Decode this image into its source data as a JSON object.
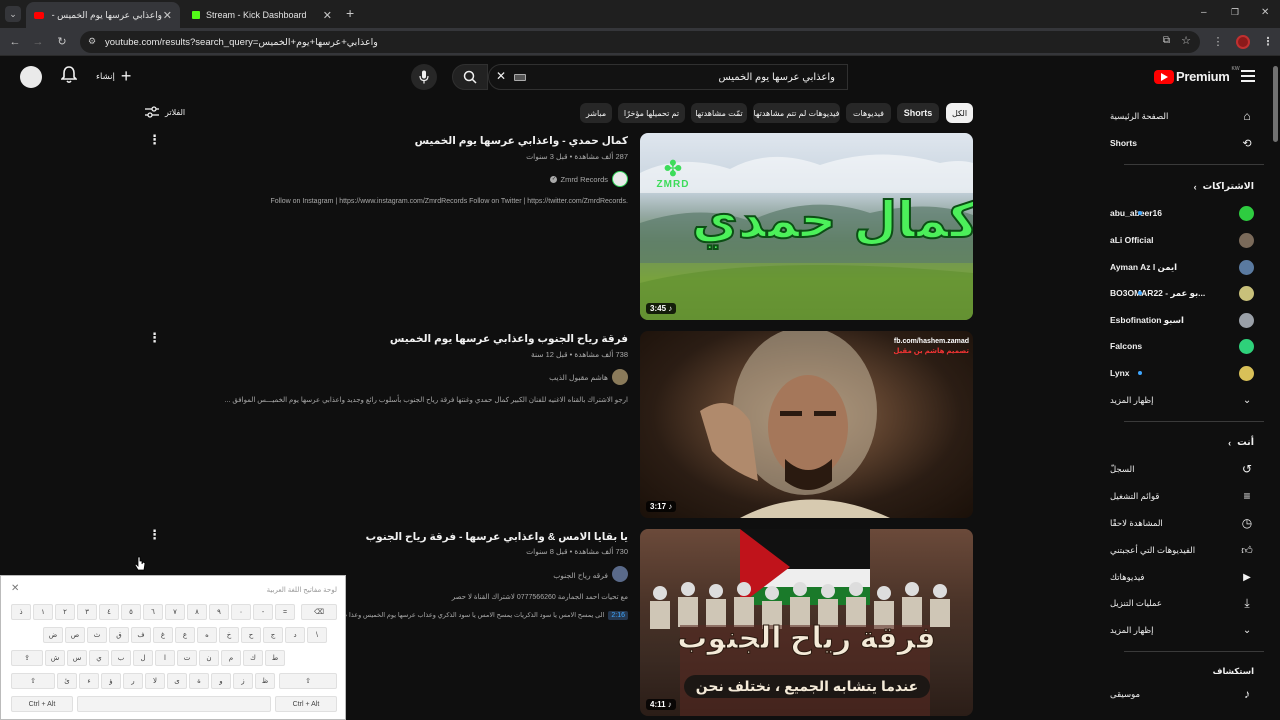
{
  "browser": {
    "tabs": [
      {
        "title": "واعذابي عرسها يوم الخميس - ube",
        "active": true
      },
      {
        "title": "Stream - Kick Dashboard",
        "active": false
      }
    ],
    "new_tab": "+",
    "url": "youtube.com/results?search_query=واعذابي+عرسها+يوم+الخميس",
    "window_controls": {
      "minimize": "–",
      "restore": "❐",
      "close": "✕"
    }
  },
  "header": {
    "logo_text": "Premium",
    "logo_sup": "KW",
    "search_value": "واعذابي عرسها يوم الخميس",
    "create_label": "إنشاء"
  },
  "chips": [
    "الكل",
    "Shorts",
    "فيديوهات",
    "فيديوهات لم تتم مشاهدتها",
    "تمّت مشاهدتها",
    "تم تحميلها مؤخرًا",
    "مباشر"
  ],
  "filters_label": "الفلاتر",
  "results": [
    {
      "title": "كمال حمدي - واعذابي عرسها يوم الخميس",
      "meta": "287 ألف مشاهدة • قبل 3 سنوات",
      "channel": "Zmrd Records",
      "verified": true,
      "description": "Follow on Instagram | https://www.instagram.com/ZmrdRecords Follow on Twitter | https://twitter.com/ZmrdRecords.",
      "duration": "3:45",
      "thumb_text": "كمال حمدي",
      "thumb_logo": "ZMRD"
    },
    {
      "title": "فرقة رياح الجنوب واعذابي عرسها يوم الخميس",
      "meta": "738 ألف مشاهدة • قبل 12 سنة",
      "channel": "هاشم مقبول الذيب",
      "verified": false,
      "description": "ارجو الاشتراك بالقناه الاغنيه للفنان الكبير كمال حمدي وغنتها فرقة رياح الجنوب بأسلوب رائع وجديد واعذابي عرسها يوم الخميـــس الموافق ...",
      "duration": "3:17",
      "thumb_text": "تصميم هاشم بن مقبل",
      "thumb_logo": "fb.com/hashem.zamad"
    },
    {
      "title": "يا بقايا الامس & واعذابي عرسها - فرقة رياح الجنوب",
      "meta": "730 ألف مشاهدة • قبل 8 سنوات",
      "channel": "فرقه رياح الجنوب",
      "verified": false,
      "description": "مع تحيات احمد الجمارمة 0777566260 لاشتراك القناة لا حصر",
      "chapter_time": "2:16",
      "chapter_text": "الى يمسح الامس يا سود الذكريات يمسح الامس يا سود الذكري وعذاب عرسها يوم الخميس وعذا ب ...",
      "duration": "4:11",
      "thumb_text": "فرقة رياح الجنوب",
      "thumb_sub": "عندما يتشابه الجميع ، نختلف نحن"
    }
  ],
  "sidebar": {
    "top": [
      {
        "label": "الصفحة الرئيسية",
        "icon": "home-icon"
      },
      {
        "label": "Shorts",
        "icon": "shorts-icon"
      }
    ],
    "subs_heading": "الاشتراكات",
    "subs": [
      {
        "label": "abu_abeer16",
        "dot": true,
        "color": "#2ecc40"
      },
      {
        "label": "aLi Official",
        "dot": false,
        "color": "#7a6a5a"
      },
      {
        "label": "Ayman Az l ايمن",
        "dot": false,
        "color": "#5a7aa0"
      },
      {
        "label": "BO3OMAR22 - بو عمر...",
        "dot": true,
        "color": "#c8c07a"
      },
      {
        "label": "Esbofination اسبو",
        "dot": false,
        "color": "#9aa0a8"
      },
      {
        "label": "Falcons",
        "dot": false,
        "color": "#2ed17a"
      },
      {
        "label": "Lynx",
        "dot": true,
        "color": "#d8c058"
      }
    ],
    "show_more": "إظهار المزيد",
    "you_heading": "أنت",
    "you": [
      {
        "label": "السجلّ",
        "icon": "history-icon"
      },
      {
        "label": "قوائم التشغيل",
        "icon": "playlists-icon"
      },
      {
        "label": "المشاهدة لاحقًا",
        "icon": "watch-later-icon"
      },
      {
        "label": "الفيديوهات التي أعجبتني",
        "icon": "like-icon"
      },
      {
        "label": "فيديوهاتك",
        "icon": "your-videos-icon"
      },
      {
        "label": "عمليات التنزيل",
        "icon": "download-icon"
      }
    ],
    "show_more_2": "إظهار المزيد",
    "explore_heading": "استكشاف",
    "explore": [
      {
        "label": "موسيقى",
        "icon": "music-icon"
      }
    ]
  },
  "keyboard": {
    "title": "لوحة مفاتيح اللغة العربية",
    "row1": [
      "ذ",
      "١",
      "٢",
      "٣",
      "٤",
      "٥",
      "٦",
      "٧",
      "٨",
      "٩",
      "٠",
      "-",
      "="
    ],
    "row2": [
      "ض",
      "ص",
      "ث",
      "ق",
      "ف",
      "غ",
      "ع",
      "ه",
      "خ",
      "ح",
      "ج",
      "د",
      "\\"
    ],
    "row3": [
      "ش",
      "س",
      "ي",
      "ب",
      "ل",
      "ا",
      "ت",
      "ن",
      "م",
      "ك",
      "ط"
    ],
    "row4": [
      "ئ",
      "ء",
      "ؤ",
      "ر",
      "لا",
      "ى",
      "ة",
      "و",
      "ز",
      "ظ"
    ],
    "ctrl_alt": "Ctrl + Alt"
  },
  "colors": {
    "accent": "#ff0000",
    "background": "#0f0f0f",
    "chip": "#272727"
  }
}
